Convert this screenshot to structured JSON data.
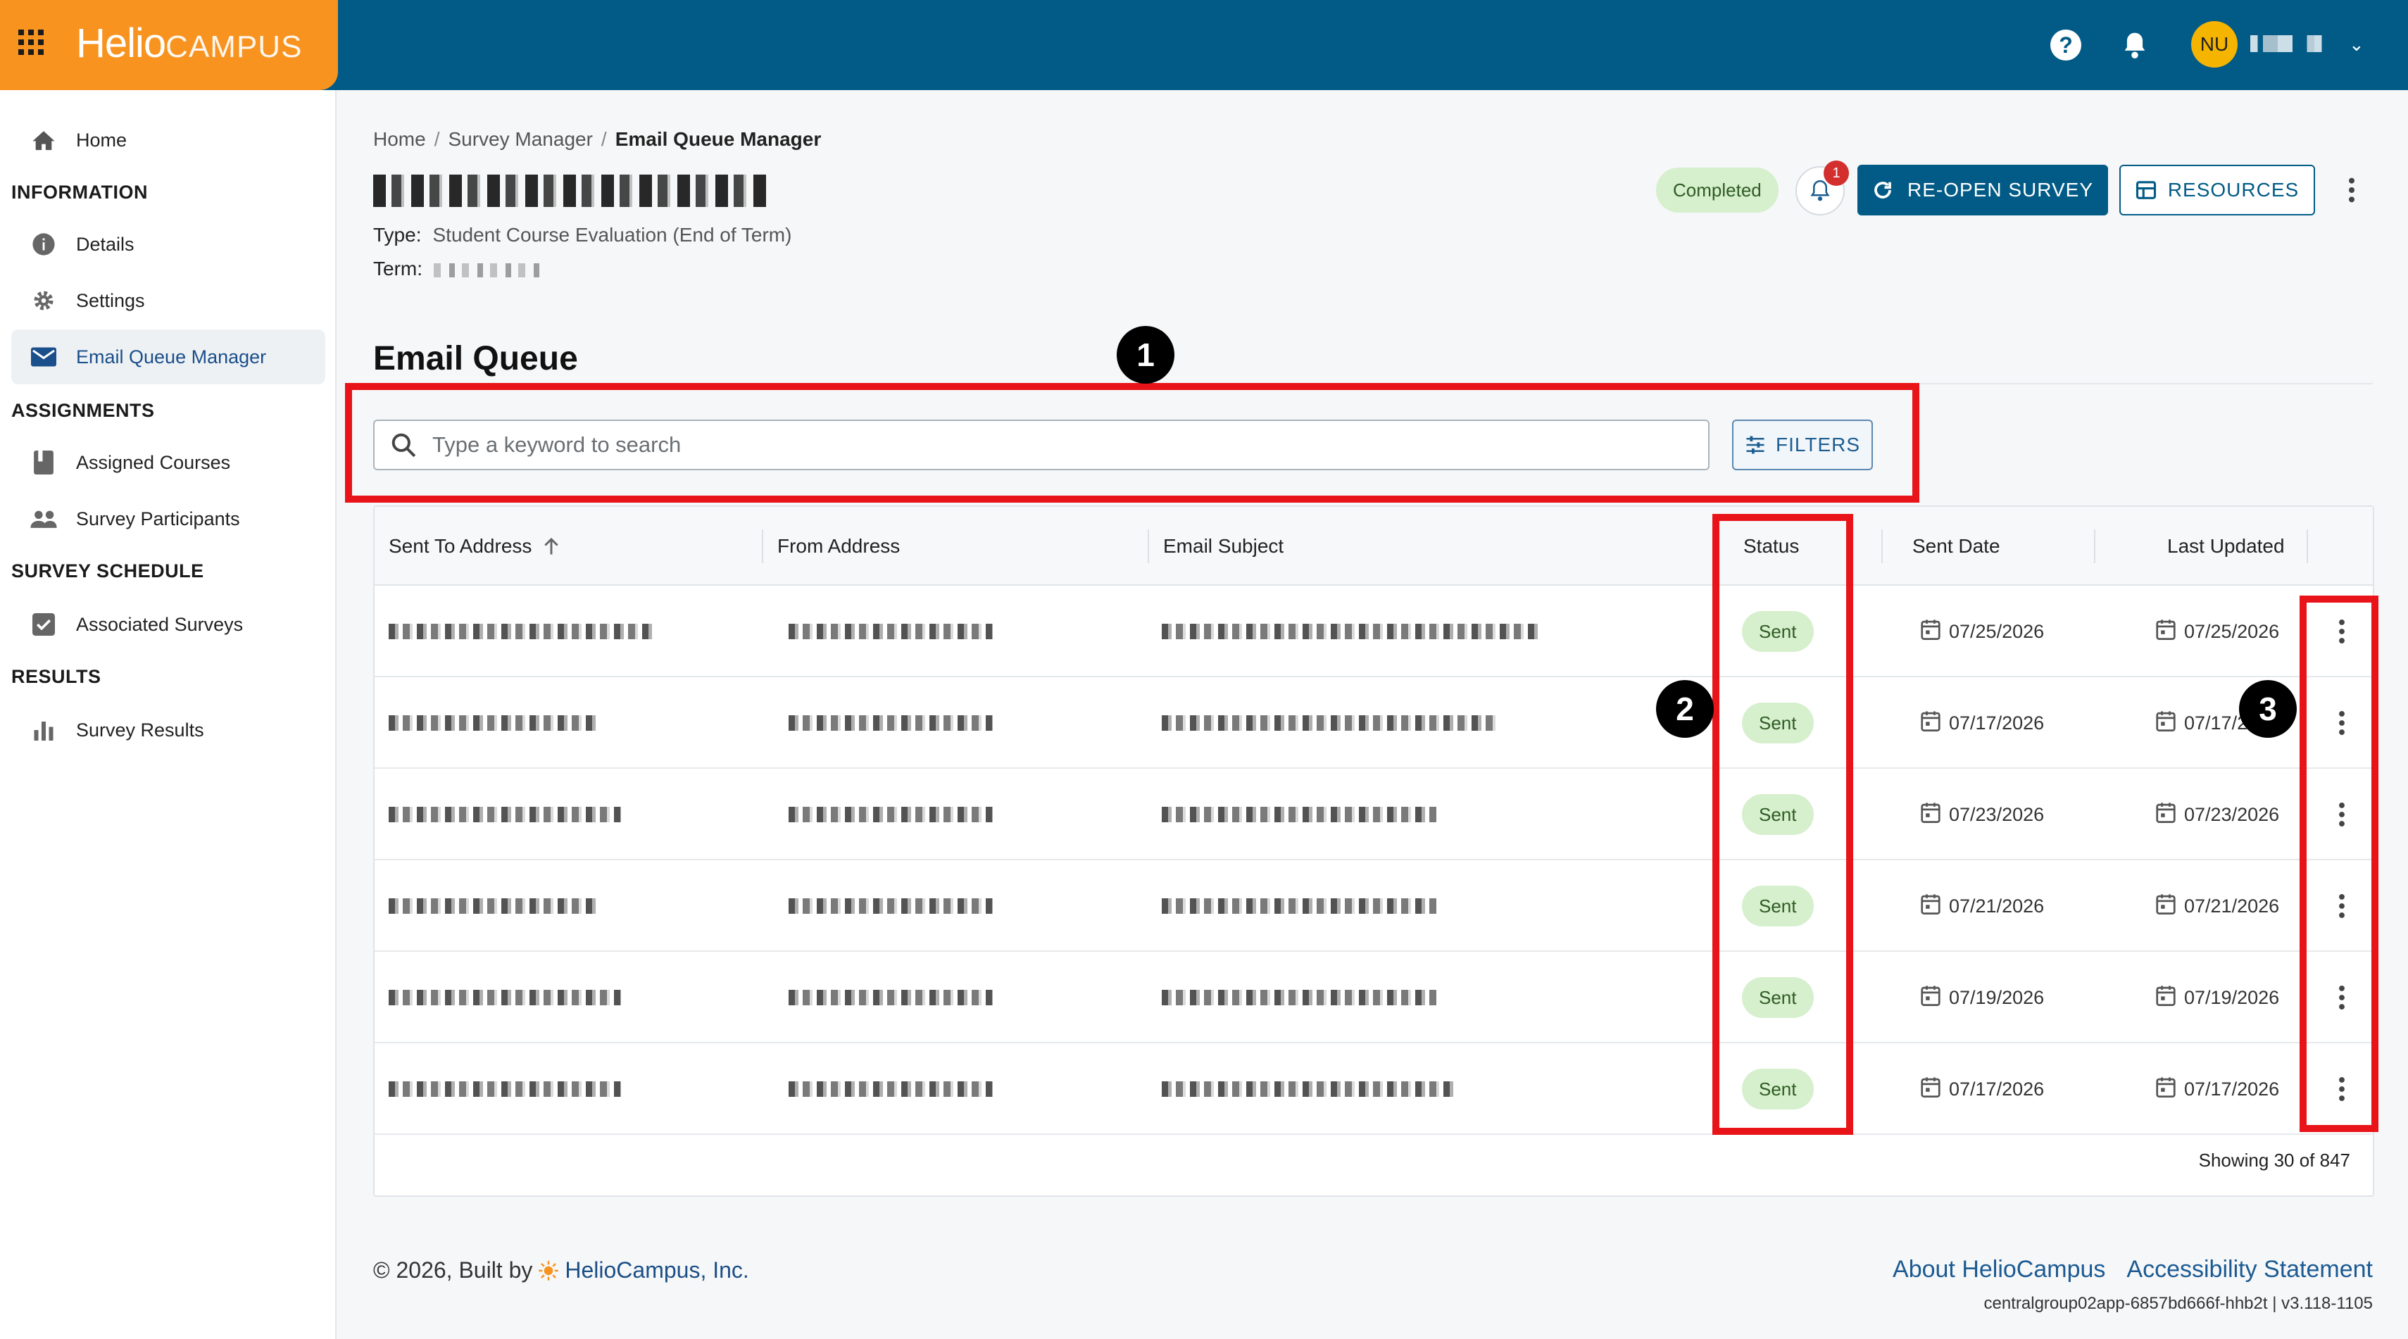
{
  "app": {
    "logo_main": "Helio",
    "logo_sub": "CAMPUS",
    "user_initials": "NU"
  },
  "sidebar": {
    "home": "Home",
    "sections": [
      {
        "title": "INFORMATION",
        "items": [
          "Details",
          "Settings",
          "Email Queue Manager"
        ]
      },
      {
        "title": "ASSIGNMENTS",
        "items": [
          "Assigned Courses",
          "Survey Participants"
        ]
      },
      {
        "title": "SURVEY SCHEDULE",
        "items": [
          "Associated Surveys"
        ]
      },
      {
        "title": "RESULTS",
        "items": [
          "Survey Results"
        ]
      }
    ],
    "active_item": "Email Queue Manager"
  },
  "breadcrumb": {
    "home": "Home",
    "separator": "/",
    "parent": "Survey Manager",
    "current": "Email Queue Manager"
  },
  "survey": {
    "type_label": "Type:",
    "type_value": "Student Course Evaluation (End of Term)",
    "term_label": "Term:",
    "status": "Completed",
    "notification_count": "1"
  },
  "actions": {
    "reopen": "RE-OPEN SURVEY",
    "resources": "RESOURCES"
  },
  "email_queue": {
    "title": "Email Queue",
    "search_placeholder": "Type a keyword to search",
    "filters": "FILTERS",
    "columns": [
      "Sent To Address",
      "From Address",
      "Email Subject",
      "Status",
      "Sent Date",
      "Last Updated"
    ],
    "rows": [
      {
        "status": "Sent",
        "sent_date": "07/25/2026",
        "last_updated": "07/25/2026"
      },
      {
        "status": "Sent",
        "sent_date": "07/17/2026",
        "last_updated": "07/17/2026"
      },
      {
        "status": "Sent",
        "sent_date": "07/23/2026",
        "last_updated": "07/23/2026"
      },
      {
        "status": "Sent",
        "sent_date": "07/21/2026",
        "last_updated": "07/21/2026"
      },
      {
        "status": "Sent",
        "sent_date": "07/19/2026",
        "last_updated": "07/19/2026"
      },
      {
        "status": "Sent",
        "sent_date": "07/17/2026",
        "last_updated": "07/17/2026"
      }
    ],
    "showing": "Showing 30 of 847"
  },
  "annotations": [
    "1",
    "2",
    "3"
  ],
  "footer": {
    "copyright": "© 2026, Built by",
    "company": "HelioCampus, Inc.",
    "about": "About HelioCampus",
    "accessibility": "Accessibility Statement",
    "version": "centralgroup02app-6857bd666f-hhb2t | v3.118-1105"
  },
  "colors": {
    "brand_orange": "#f7931e",
    "header_blue": "#025b86",
    "status_green_bg": "#d6efcd",
    "annotation_red": "#e8141a"
  }
}
